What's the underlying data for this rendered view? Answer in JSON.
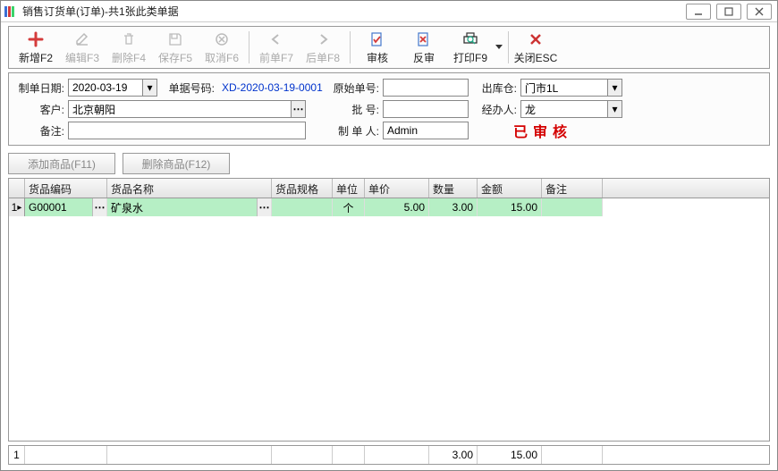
{
  "title": "销售订货单(订单)-共1张此类单据",
  "toolbar": {
    "new": "新增F2",
    "edit": "编辑F3",
    "delete": "删除F4",
    "save": "保存F5",
    "cancel": "取消F6",
    "prev": "前单F7",
    "next": "后单F8",
    "audit": "审核",
    "unaudit": "反审",
    "print": "打印F9",
    "close": "关闭ESC"
  },
  "form": {
    "date_label": "制单日期:",
    "date_value": "2020-03-19",
    "docno_label": "单据号码:",
    "docno_value": "XD-2020-03-19-0001",
    "origdoc_label": "原始单号:",
    "origdoc_value": "",
    "warehouse_label": "出库仓:",
    "warehouse_value": "门市1L",
    "customer_label": "客户:",
    "customer_value": "北京朝阳",
    "batch_label": "批    号:",
    "batch_value": "",
    "handler_label": "经办人:",
    "handler_value": "龙",
    "remark_label": "备注:",
    "remark_value": "",
    "creator_label": "制 单 人:",
    "creator_value": "Admin",
    "status_stamp": "已审核"
  },
  "buttons": {
    "add_item": "添加商品(F11)",
    "del_item": "删除商品(F12)"
  },
  "grid": {
    "headers": {
      "code": "货品编码",
      "name": "货品名称",
      "spec": "货品规格",
      "unit": "单位",
      "price": "单价",
      "qty": "数量",
      "amount": "金额",
      "remark": "备注"
    },
    "rows": [
      {
        "idx": "1",
        "code": "G00001",
        "name": "矿泉水",
        "spec": "",
        "unit": "个",
        "price": "5.00",
        "qty": "3.00",
        "amount": "15.00",
        "remark": ""
      }
    ]
  },
  "footer": {
    "idx": "1",
    "qty": "3.00",
    "amount": "15.00"
  }
}
